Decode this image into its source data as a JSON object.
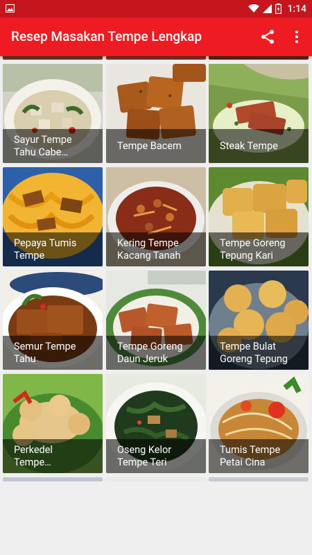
{
  "status_bar": {
    "time": "1:14"
  },
  "app_bar": {
    "title": "Resep Masakan Tempe Lengkap",
    "share_icon": "share-icon",
    "more_icon": "more-vert-icon"
  },
  "colors": {
    "status_bar": "#c4161c",
    "app_bar": "#ef1b22",
    "background": "#efefef"
  },
  "recipes": [
    {
      "line1": "Sayur Tempe",
      "line2": "Tahu Cabe…"
    },
    {
      "line1": "Tempe Bacem",
      "line2": ""
    },
    {
      "line1": "Steak Tempe",
      "line2": ""
    },
    {
      "line1": "Pepaya Tumis",
      "line2": "Tempe"
    },
    {
      "line1": "Kering Tempe",
      "line2": "Kacang Tanah"
    },
    {
      "line1": "Tempe Goreng",
      "line2": "Tepung Kari"
    },
    {
      "line1": "Semur Tempe",
      "line2": "Tahu"
    },
    {
      "line1": "Tempe Goreng",
      "line2": "Daun Jeruk"
    },
    {
      "line1": "Tempe Bulat",
      "line2": "Goreng Tepung"
    },
    {
      "line1": "Perkedel",
      "line2": "Tempe…"
    },
    {
      "line1": "Oseng Kelor",
      "line2": "Tempe Teri"
    },
    {
      "line1": "Tumis Tempe",
      "line2": "Petai Cina"
    }
  ]
}
